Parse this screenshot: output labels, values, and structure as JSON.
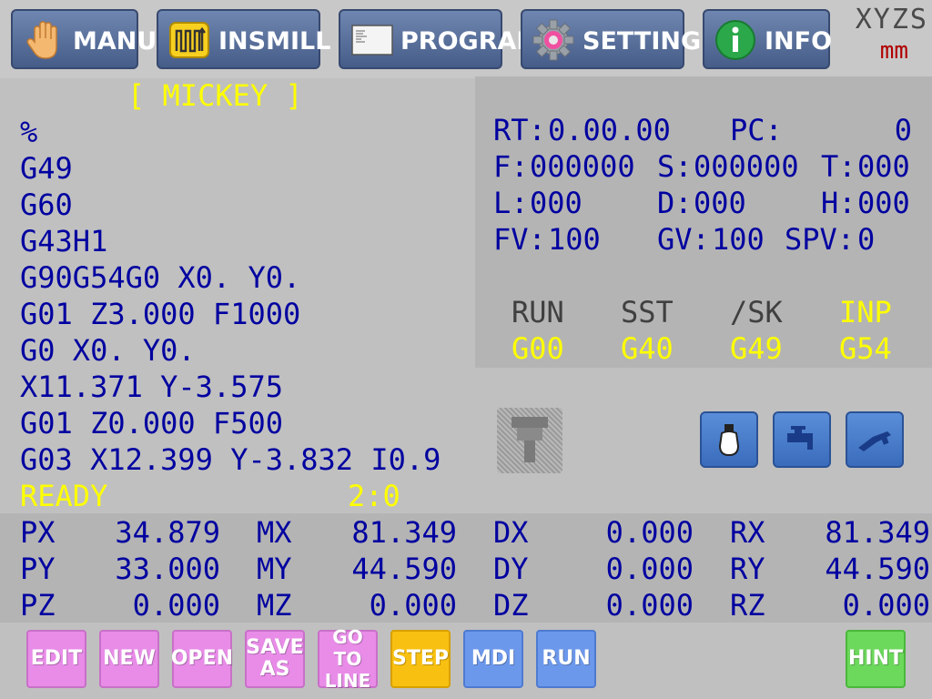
{
  "tabs": [
    {
      "id": "manual",
      "label": "MANUAL",
      "icon": "hand-icon",
      "active": false
    },
    {
      "id": "insmill",
      "label": "INSMILL",
      "icon": "insmill-icon",
      "active": false
    },
    {
      "id": "program",
      "label": "PROGRAM",
      "icon": "program-icon",
      "active": true
    },
    {
      "id": "setting",
      "label": "SETTING",
      "icon": "gear-icon",
      "active": false
    },
    {
      "id": "info",
      "label": "INFO",
      "icon": "info-icon",
      "active": false
    }
  ],
  "unit": {
    "axes": "XYZS",
    "unit": "mm"
  },
  "program": {
    "title": "[ MICKEY ]",
    "lines": [
      "%",
      "G49",
      "G60",
      "G43H1",
      "G90G54G0 X0. Y0.",
      "G01 Z3.000 F1000",
      "G0 X0. Y0.",
      "X11.371 Y-3.575",
      "G01 Z0.000 F500",
      "G03 X12.399 Y-3.832 I0.9"
    ],
    "status": "READY",
    "line_position": "2:0"
  },
  "info": {
    "rt_label": "RT:",
    "rt_value": "0.00.00",
    "pc_label": "PC:",
    "pc_value": "0",
    "f_label": "F:",
    "f_value": "000000",
    "s_label": "S:",
    "s_value": "000000",
    "t_label": "T:",
    "t_value": "000",
    "l_label": "L:",
    "l_value": "000",
    "d_label": "D:",
    "d_value": "000",
    "h_label": "H:",
    "h_value": "000",
    "fv_label": "FV:",
    "fv_value": "100",
    "gv_label": "GV:",
    "gv_value": "100",
    "spv_label": "SPV:",
    "spv_value": "0"
  },
  "modes": [
    {
      "label": "RUN",
      "value": "G00",
      "label_color": "#404040"
    },
    {
      "label": "SST",
      "value": "G40",
      "label_color": "#404040"
    },
    {
      "label": "/SK",
      "value": "G49",
      "label_color": "#404040"
    },
    {
      "label": "INP",
      "value": "G54",
      "label_color": "#ffff00"
    }
  ],
  "coords": [
    {
      "p_label": "PX",
      "p_value": "34.879",
      "m_label": "MX",
      "m_value": "81.349",
      "d_label": "DX",
      "d_value": "0.000",
      "r_label": "RX",
      "r_value": "81.349"
    },
    {
      "p_label": "PY",
      "p_value": "33.000",
      "m_label": "MY",
      "m_value": "44.590",
      "d_label": "DY",
      "d_value": "0.000",
      "r_label": "RY",
      "r_value": "44.590"
    },
    {
      "p_label": "PZ",
      "p_value": "0.000",
      "m_label": "MZ",
      "m_value": "0.000",
      "d_label": "DZ",
      "d_value": "0.000",
      "r_label": "RZ",
      "r_value": "0.000"
    }
  ],
  "tool_buttons": [
    {
      "name": "tool-icon"
    },
    {
      "name": "lamp-icon"
    },
    {
      "name": "coolant-icon"
    },
    {
      "name": "air-blow-icon"
    }
  ],
  "bottom_buttons": [
    {
      "id": "edit",
      "lines": [
        "EDIT"
      ],
      "color": "#e88ce8"
    },
    {
      "id": "new",
      "lines": [
        "NEW"
      ],
      "color": "#e88ce8"
    },
    {
      "id": "open",
      "lines": [
        "OPEN"
      ],
      "color": "#e88ce8"
    },
    {
      "id": "save-as",
      "lines": [
        "SAVE",
        "AS"
      ],
      "color": "#e88ce8"
    },
    {
      "id": "go-to-line",
      "lines": [
        "GO TO",
        "LINE"
      ],
      "color": "#e88ce8"
    },
    {
      "id": "step",
      "lines": [
        "STEP"
      ],
      "color": "#f8c010"
    },
    {
      "id": "mdi",
      "lines": [
        "MDI"
      ],
      "color": "#6c98ec"
    },
    {
      "id": "run",
      "lines": [
        "RUN"
      ],
      "color": "#6c98ec"
    },
    {
      "id": "hint",
      "lines": [
        "HINT"
      ],
      "color": "#6cd85c"
    }
  ]
}
